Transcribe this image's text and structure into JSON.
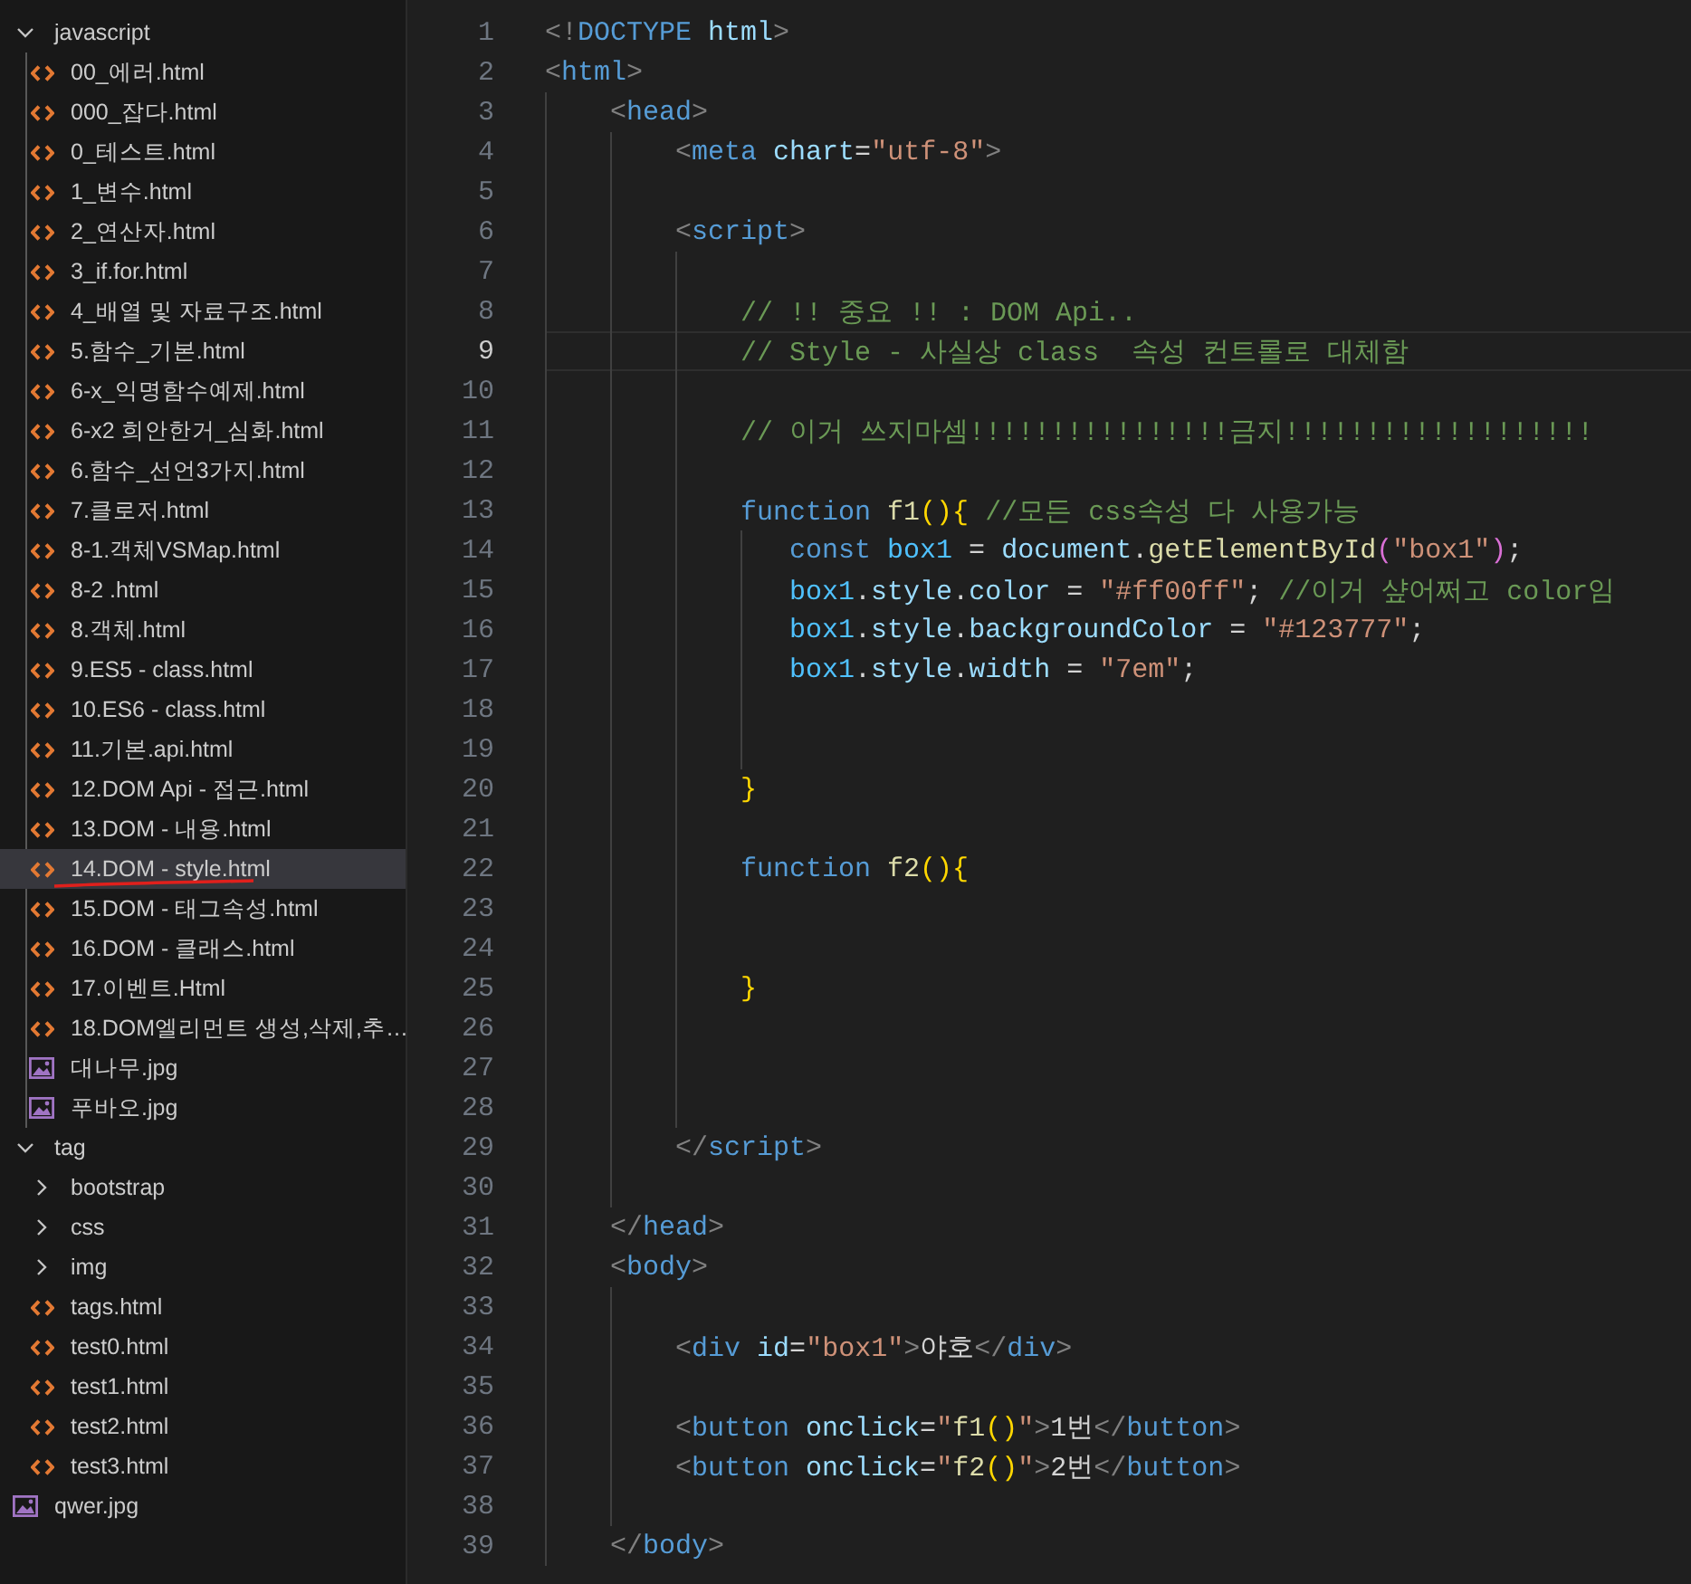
{
  "explorer": {
    "items": [
      {
        "kind": "folder",
        "label": "javascript",
        "expanded": true,
        "selected": false,
        "children": [
          {
            "kind": "html",
            "label": "00_에러.html",
            "selected": false
          },
          {
            "kind": "html",
            "label": "000_잡다.html",
            "selected": false
          },
          {
            "kind": "html",
            "label": "0_테스트.html",
            "selected": false
          },
          {
            "kind": "html",
            "label": "1_변수.html",
            "selected": false
          },
          {
            "kind": "html",
            "label": "2_연산자.html",
            "selected": false
          },
          {
            "kind": "html",
            "label": "3_if.for.html",
            "selected": false
          },
          {
            "kind": "html",
            "label": "4_배열 및 자료구조.html",
            "selected": false
          },
          {
            "kind": "html",
            "label": "5.함수_기본.html",
            "selected": false
          },
          {
            "kind": "html",
            "label": "6-x_익명함수예제.html",
            "selected": false
          },
          {
            "kind": "html",
            "label": "6-x2 희안한거_심화.html",
            "selected": false
          },
          {
            "kind": "html",
            "label": "6.함수_선언3가지.html",
            "selected": false
          },
          {
            "kind": "html",
            "label": "7.클로저.html",
            "selected": false
          },
          {
            "kind": "html",
            "label": "8-1.객체VSMap.html",
            "selected": false
          },
          {
            "kind": "html",
            "label": "8-2 .html",
            "selected": false
          },
          {
            "kind": "html",
            "label": "8.객체.html",
            "selected": false
          },
          {
            "kind": "html",
            "label": "9.ES5 - class.html",
            "selected": false
          },
          {
            "kind": "html",
            "label": "10.ES6 - class.html",
            "selected": false
          },
          {
            "kind": "html",
            "label": "11.기본.api.html",
            "selected": false
          },
          {
            "kind": "html",
            "label": "12.DOM Api - 접근.html",
            "selected": false
          },
          {
            "kind": "html",
            "label": "13.DOM - 내용.html",
            "selected": false
          },
          {
            "kind": "html",
            "label": "14.DOM - style.html",
            "selected": true
          },
          {
            "kind": "html",
            "label": "15.DOM - 태그속성.html",
            "selected": false
          },
          {
            "kind": "html",
            "label": "16.DOM - 클래스.html",
            "selected": false
          },
          {
            "kind": "html",
            "label": "17.이벤트.Html",
            "selected": false
          },
          {
            "kind": "html",
            "label": "18.DOM엘리먼트 생성,삭제,추…",
            "selected": false
          },
          {
            "kind": "image",
            "label": "대나무.jpg",
            "selected": false
          },
          {
            "kind": "image",
            "label": "푸바오.jpg",
            "selected": false
          }
        ]
      },
      {
        "kind": "folder",
        "label": "tag",
        "expanded": true,
        "selected": false,
        "children": [
          {
            "kind": "folder",
            "label": "bootstrap",
            "expanded": false,
            "selected": false
          },
          {
            "kind": "folder",
            "label": "css",
            "expanded": false,
            "selected": false
          },
          {
            "kind": "folder",
            "label": "img",
            "expanded": false,
            "selected": false
          },
          {
            "kind": "html",
            "label": "tags.html",
            "selected": false
          },
          {
            "kind": "html",
            "label": "test0.html",
            "selected": false
          },
          {
            "kind": "html",
            "label": "test1.html",
            "selected": false
          },
          {
            "kind": "html",
            "label": "test2.html",
            "selected": false
          },
          {
            "kind": "html",
            "label": "test3.html",
            "selected": false
          }
        ]
      },
      {
        "kind": "image",
        "label": "qwer.jpg",
        "selected": false
      }
    ]
  },
  "editor": {
    "lines": [
      {
        "number": "1",
        "current": false,
        "tokens": [
          {
            "kind": "punct",
            "text": "<!"
          },
          {
            "kind": "tag",
            "text": "DOCTYPE "
          },
          {
            "kind": "attr",
            "text": "html"
          },
          {
            "kind": "punct",
            "text": ">"
          }
        ]
      },
      {
        "number": "2",
        "current": false,
        "tokens": [
          {
            "kind": "punct",
            "text": "<"
          },
          {
            "kind": "tag",
            "text": "html"
          },
          {
            "kind": "punct",
            "text": ">"
          }
        ]
      },
      {
        "number": "3",
        "current": false,
        "tokens": [
          {
            "kind": "punct",
            "text": "    <"
          },
          {
            "kind": "tag",
            "text": "head"
          },
          {
            "kind": "punct",
            "text": ">"
          }
        ]
      },
      {
        "number": "4",
        "current": false,
        "tokens": [
          {
            "kind": "punct",
            "text": "        <"
          },
          {
            "kind": "tag",
            "text": "meta "
          },
          {
            "kind": "attr",
            "text": "chart"
          },
          {
            "kind": "plain",
            "text": "="
          },
          {
            "kind": "string",
            "text": "\"utf-8\""
          },
          {
            "kind": "punct",
            "text": ">"
          }
        ]
      },
      {
        "number": "5",
        "current": false
      },
      {
        "number": "6",
        "current": false,
        "tokens": [
          {
            "kind": "punct",
            "text": "        <"
          },
          {
            "kind": "tag",
            "text": "script"
          },
          {
            "kind": "punct",
            "text": ">"
          }
        ]
      },
      {
        "number": "7",
        "current": false
      },
      {
        "number": "8",
        "current": false,
        "tokens": [
          {
            "kind": "comment",
            "text": "            // !! 중요 !! : DOM Api.."
          }
        ]
      },
      {
        "number": "9",
        "current": true,
        "tokens": [
          {
            "kind": "comment",
            "text": "            // Style - 사실상 class  속성 컨트롤로 대체함"
          }
        ]
      },
      {
        "number": "10",
        "current": false
      },
      {
        "number": "11",
        "current": false,
        "tokens": [
          {
            "kind": "comment",
            "text": "            // 이거 쓰지마셈!!!!!!!!!!!!!!!!금지!!!!!!!!!!!!!!!!!!!"
          }
        ]
      },
      {
        "number": "12",
        "current": false
      },
      {
        "number": "13",
        "current": false,
        "tokens": [
          {
            "kind": "keyword",
            "text": "            function "
          },
          {
            "kind": "function",
            "text": "f1"
          },
          {
            "kind": "bracket",
            "text": "(){"
          },
          {
            "kind": "comment",
            "text": " //모든 css속성 다 사용가능"
          }
        ]
      },
      {
        "number": "14",
        "current": false,
        "tokens": [
          {
            "kind": "keyword",
            "text": "               const "
          },
          {
            "kind": "constant",
            "text": "box1"
          },
          {
            "kind": "plain",
            "text": " = "
          },
          {
            "kind": "variable",
            "text": "document"
          },
          {
            "kind": "plain",
            "text": "."
          },
          {
            "kind": "function",
            "text": "getElementById"
          },
          {
            "kind": "bracket2",
            "text": "("
          },
          {
            "kind": "string",
            "text": "\"box1\""
          },
          {
            "kind": "bracket2",
            "text": ")"
          },
          {
            "kind": "plain",
            "text": ";"
          }
        ]
      },
      {
        "number": "15",
        "current": false,
        "tokens": [
          {
            "kind": "constant",
            "text": "               box1"
          },
          {
            "kind": "plain",
            "text": "."
          },
          {
            "kind": "variable",
            "text": "style"
          },
          {
            "kind": "plain",
            "text": "."
          },
          {
            "kind": "variable",
            "text": "color"
          },
          {
            "kind": "plain",
            "text": " = "
          },
          {
            "kind": "string",
            "text": "\"#ff00ff\""
          },
          {
            "kind": "plain",
            "text": "; "
          },
          {
            "kind": "comment",
            "text": "//이거 샾어쩌고 color임"
          }
        ]
      },
      {
        "number": "16",
        "current": false,
        "tokens": [
          {
            "kind": "constant",
            "text": "               box1"
          },
          {
            "kind": "plain",
            "text": "."
          },
          {
            "kind": "variable",
            "text": "style"
          },
          {
            "kind": "plain",
            "text": "."
          },
          {
            "kind": "variable",
            "text": "backgroundColor"
          },
          {
            "kind": "plain",
            "text": " = "
          },
          {
            "kind": "string",
            "text": "\"#123777\""
          },
          {
            "kind": "plain",
            "text": ";"
          }
        ]
      },
      {
        "number": "17",
        "current": false,
        "tokens": [
          {
            "kind": "constant",
            "text": "               box1"
          },
          {
            "kind": "plain",
            "text": "."
          },
          {
            "kind": "variable",
            "text": "style"
          },
          {
            "kind": "plain",
            "text": "."
          },
          {
            "kind": "variable",
            "text": "width"
          },
          {
            "kind": "plain",
            "text": " = "
          },
          {
            "kind": "string",
            "text": "\"7em\""
          },
          {
            "kind": "plain",
            "text": ";"
          }
        ]
      },
      {
        "number": "18",
        "current": false
      },
      {
        "number": "19",
        "current": false
      },
      {
        "number": "20",
        "current": false,
        "tokens": [
          {
            "kind": "bracket",
            "text": "            }"
          }
        ]
      },
      {
        "number": "21",
        "current": false
      },
      {
        "number": "22",
        "current": false,
        "tokens": [
          {
            "kind": "keyword",
            "text": "            function "
          },
          {
            "kind": "function",
            "text": "f2"
          },
          {
            "kind": "bracket",
            "text": "(){"
          }
        ]
      },
      {
        "number": "23",
        "current": false
      },
      {
        "number": "24",
        "current": false
      },
      {
        "number": "25",
        "current": false,
        "tokens": [
          {
            "kind": "bracket",
            "text": "            }"
          }
        ]
      },
      {
        "number": "26",
        "current": false
      },
      {
        "number": "27",
        "current": false
      },
      {
        "number": "28",
        "current": false
      },
      {
        "number": "29",
        "current": false,
        "tokens": [
          {
            "kind": "punct",
            "text": "        </"
          },
          {
            "kind": "tag",
            "text": "script"
          },
          {
            "kind": "punct",
            "text": ">"
          }
        ]
      },
      {
        "number": "30",
        "current": false
      },
      {
        "number": "31",
        "current": false,
        "tokens": [
          {
            "kind": "punct",
            "text": "    </"
          },
          {
            "kind": "tag",
            "text": "head"
          },
          {
            "kind": "punct",
            "text": ">"
          }
        ]
      },
      {
        "number": "32",
        "current": false,
        "tokens": [
          {
            "kind": "punct",
            "text": "    <"
          },
          {
            "kind": "tag",
            "text": "body"
          },
          {
            "kind": "punct",
            "text": ">"
          }
        ]
      },
      {
        "number": "33",
        "current": false
      },
      {
        "number": "34",
        "current": false,
        "tokens": [
          {
            "kind": "punct",
            "text": "        <"
          },
          {
            "kind": "tag",
            "text": "div "
          },
          {
            "kind": "attr",
            "text": "id"
          },
          {
            "kind": "plain",
            "text": "="
          },
          {
            "kind": "string",
            "text": "\"box1\""
          },
          {
            "kind": "punct",
            "text": ">"
          },
          {
            "kind": "plain",
            "text": "야호"
          },
          {
            "kind": "punct",
            "text": "</"
          },
          {
            "kind": "tag",
            "text": "div"
          },
          {
            "kind": "punct",
            "text": ">"
          }
        ]
      },
      {
        "number": "35",
        "current": false
      },
      {
        "number": "36",
        "current": false,
        "tokens": [
          {
            "kind": "punct",
            "text": "        <"
          },
          {
            "kind": "tag",
            "text": "button "
          },
          {
            "kind": "attr",
            "text": "onclick"
          },
          {
            "kind": "plain",
            "text": "="
          },
          {
            "kind": "string",
            "text": "\""
          },
          {
            "kind": "function",
            "text": "f1"
          },
          {
            "kind": "bracket",
            "text": "()"
          },
          {
            "kind": "string",
            "text": "\""
          },
          {
            "kind": "punct",
            "text": ">"
          },
          {
            "kind": "plain",
            "text": "1번"
          },
          {
            "kind": "punct",
            "text": "</"
          },
          {
            "kind": "tag",
            "text": "button"
          },
          {
            "kind": "punct",
            "text": ">"
          }
        ]
      },
      {
        "number": "37",
        "current": false,
        "tokens": [
          {
            "kind": "punct",
            "text": "        <"
          },
          {
            "kind": "tag",
            "text": "button "
          },
          {
            "kind": "attr",
            "text": "onclick"
          },
          {
            "kind": "plain",
            "text": "="
          },
          {
            "kind": "string",
            "text": "\""
          },
          {
            "kind": "function",
            "text": "f2"
          },
          {
            "kind": "bracket",
            "text": "()"
          },
          {
            "kind": "string",
            "text": "\""
          },
          {
            "kind": "punct",
            "text": ">"
          },
          {
            "kind": "plain",
            "text": "2번"
          },
          {
            "kind": "punct",
            "text": "</"
          },
          {
            "kind": "tag",
            "text": "button"
          },
          {
            "kind": "punct",
            "text": ">"
          }
        ]
      },
      {
        "number": "38",
        "current": false
      },
      {
        "number": "39",
        "current": false,
        "tokens": [
          {
            "kind": "punct",
            "text": "    </"
          },
          {
            "kind": "tag",
            "text": "body"
          },
          {
            "kind": "punct",
            "text": ">"
          }
        ]
      }
    ]
  }
}
